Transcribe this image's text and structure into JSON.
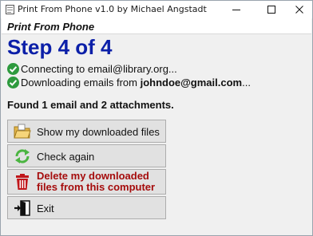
{
  "window": {
    "title": "Print From Phone v1.0 by Michael Angstadt",
    "minimize_icon": "minimize-icon",
    "maximize_icon": "maximize-icon",
    "close_icon": "close-icon"
  },
  "app_name": "Print From Phone",
  "step_title": "Step 4 of 4",
  "status": [
    {
      "icon": "check-circle-icon",
      "text_before": "Connecting to email@library.org...",
      "bold": "",
      "text_after": ""
    },
    {
      "icon": "check-circle-icon",
      "text_before": "Downloading emails from ",
      "bold": "johndoe@gmail.com",
      "text_after": "..."
    }
  ],
  "found_message": "Found 1 email and 2 attachments.",
  "buttons": {
    "show_files": {
      "label": "Show my downloaded files",
      "icon": "folder-icon"
    },
    "check_again": {
      "label": "Check again",
      "icon": "refresh-icon"
    },
    "delete_files": {
      "label": "Delete my downloaded files from this computer",
      "icon": "trash-icon"
    },
    "exit": {
      "label": "Exit",
      "icon": "exit-door-icon"
    }
  },
  "colors": {
    "step_title": "#0b1fa8",
    "check": "#2e9a3e",
    "delete_label": "#a50c0c",
    "button_face": "#e1e1e1"
  }
}
